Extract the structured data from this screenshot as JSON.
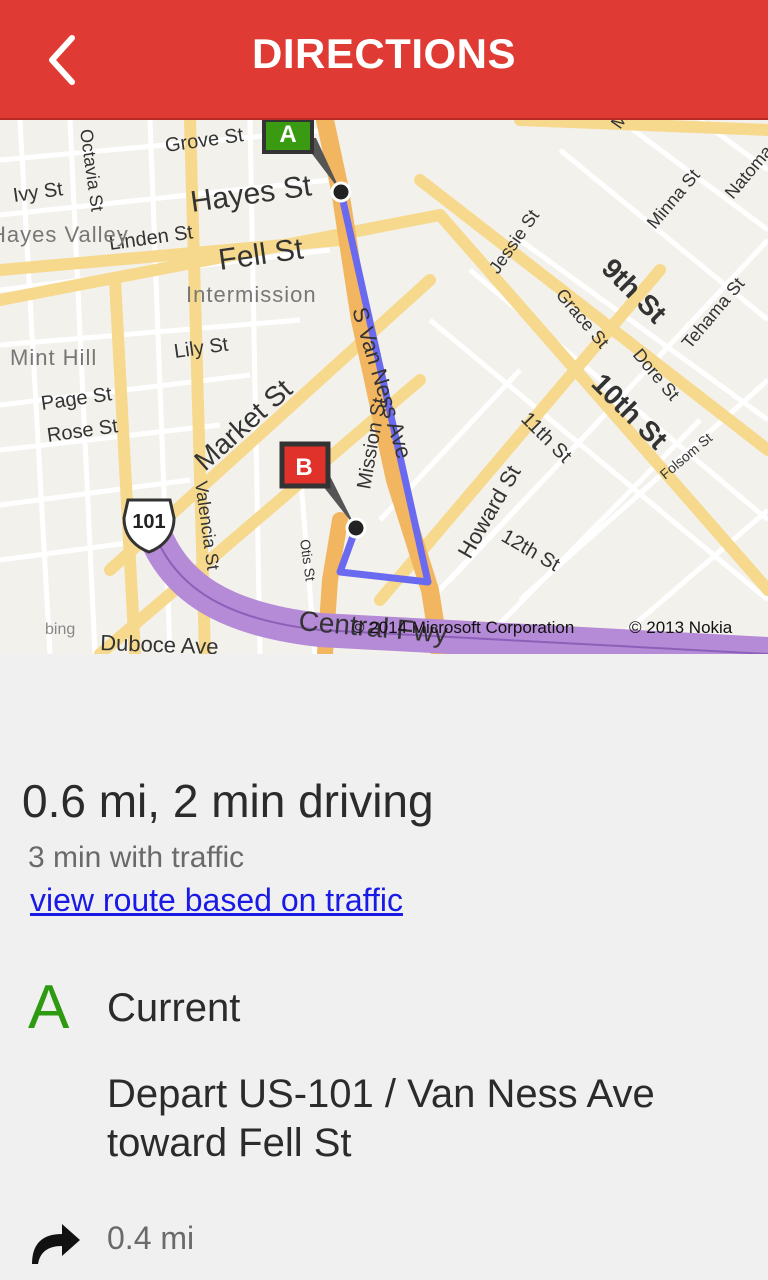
{
  "header": {
    "title": "DIRECTIONS",
    "back_icon": "chevron-left-icon"
  },
  "colors": {
    "header": "#e03a34",
    "route": "#6a6af0",
    "start_pin": "#3a9a12",
    "end_pin": "#e0312b",
    "freeway": "#b58ad6",
    "link": "#1a1ae6"
  },
  "map": {
    "start_label": "A",
    "end_label": "B",
    "street_labels": [
      "Grove St",
      "Hayes St",
      "Fell St",
      "Ivy St",
      "Linden St",
      "Octavia St",
      "Lily St",
      "Page St",
      "Rose St",
      "Market St",
      "Valencia St",
      "Otis St",
      "Duboce Ave",
      "Central Fwy",
      "S Van Ness Ave",
      "Mission St",
      "Howard St",
      "11th St",
      "12th St",
      "9th St",
      "10th St",
      "Jessie St",
      "Grace St",
      "Dore St",
      "Minna St",
      "Natoma St",
      "Tehama St",
      "Folsom St",
      "Mission St",
      "101"
    ],
    "area_labels": [
      "Hayes Valley",
      "Intermission",
      "Mint Hill"
    ],
    "attribution_ms": "© 2014 Microsoft Corporation",
    "attribution_nokia": "© 2013 Nokia",
    "bing_label": "bing"
  },
  "route": {
    "summary": "0.6 mi, 2 min driving",
    "traffic_time": "3 min with traffic",
    "traffic_link": "view route based on traffic"
  },
  "steps": [
    {
      "letter": "A",
      "title": "Current",
      "description": "Depart US-101 / Van Ness Ave toward Fell St"
    },
    {
      "icon": "turn-right-icon",
      "distance": "0.4 mi"
    }
  ]
}
